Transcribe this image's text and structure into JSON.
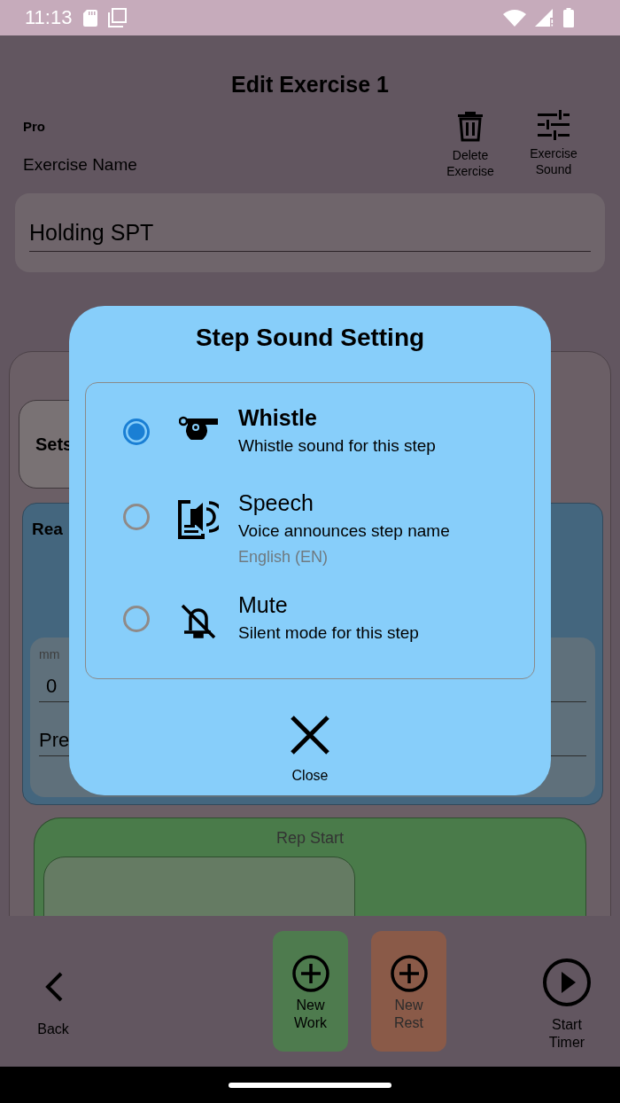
{
  "status_bar": {
    "time": "11:13"
  },
  "header": {
    "title": "Edit Exercise 1",
    "badge": "Pro",
    "name_label": "Exercise Name",
    "actions": [
      {
        "kind": "delete",
        "label": "Delete Exercise"
      },
      {
        "kind": "sound",
        "label": "Exercise Sound"
      }
    ]
  },
  "name_field": {
    "value": "Holding SPT"
  },
  "background": {
    "sets_label": "Sets",
    "ready_label": "Rea",
    "field_label": "mm",
    "field_value": "0",
    "second_field": "Pre",
    "rep_section": "Rep Start"
  },
  "dialog": {
    "title": "Step Sound Setting",
    "options": [
      {
        "kind": "whistle",
        "title": "Whistle",
        "description": "Whistle sound for this step",
        "selected": true
      },
      {
        "kind": "speech",
        "title": "Speech",
        "description": "Voice announces step name",
        "note": "English (EN)",
        "selected": false
      },
      {
        "kind": "mute",
        "title": "Mute",
        "description": "Silent mode for this step",
        "selected": false
      }
    ],
    "close_label": "Close"
  },
  "bottom_bar": {
    "buttons": [
      {
        "kind": "back",
        "label": "Back"
      },
      {
        "kind": "work",
        "label": "New Work"
      },
      {
        "kind": "rest",
        "label": "New Rest"
      },
      {
        "kind": "start",
        "label": "Start Timer"
      }
    ]
  }
}
